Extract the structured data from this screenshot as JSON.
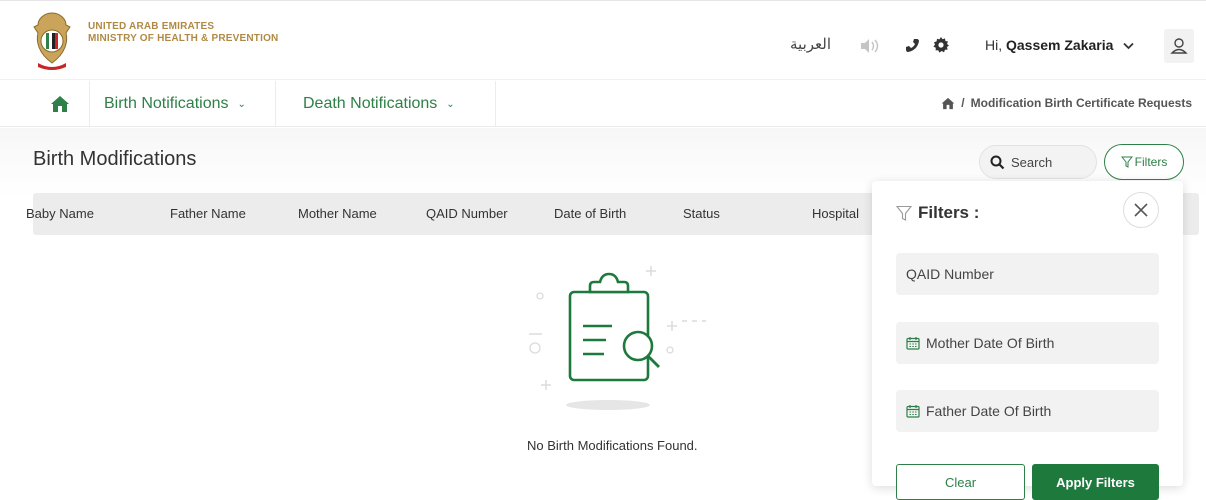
{
  "header": {
    "ministry_line1": "UNITED ARAB EMIRATES",
    "ministry_line2": "MINISTRY OF HEALTH & PREVENTION",
    "language_label": "العربية",
    "greeting_prefix": "Hi, ",
    "user_name": "Qassem Zakaria",
    "icons": [
      "emblem-icon",
      "speaker-icon",
      "phone-icon",
      "gear-icon",
      "chevron-down-icon",
      "user-icon"
    ]
  },
  "nav": {
    "items": [
      {
        "label": "Birth Notifications"
      },
      {
        "label": "Death Notifications"
      }
    ],
    "breadcrumb": {
      "separator": "/",
      "current": "Modification Birth Certificate Requests"
    }
  },
  "main": {
    "title": "Birth Modifications",
    "search_label": "Search",
    "filters_label": "Filters",
    "columns": [
      "Baby Name",
      "Father Name",
      "Mother Name",
      "QAID Number",
      "Date of Birth",
      "Status",
      "Hospital"
    ],
    "empty_message": "No Birth Modifications Found."
  },
  "filters_panel": {
    "title": "Filters :",
    "fields": {
      "qaid_placeholder": "QAID Number",
      "mother_dob_placeholder": "Mother Date Of Birth",
      "father_dob_placeholder": "Father Date Of Birth"
    },
    "clear_label": "Clear",
    "apply_label": "Apply Filters"
  },
  "colors": {
    "primary_green": "#2e8048",
    "apply_green": "#1e7a3c",
    "gold": "#b08a45"
  }
}
